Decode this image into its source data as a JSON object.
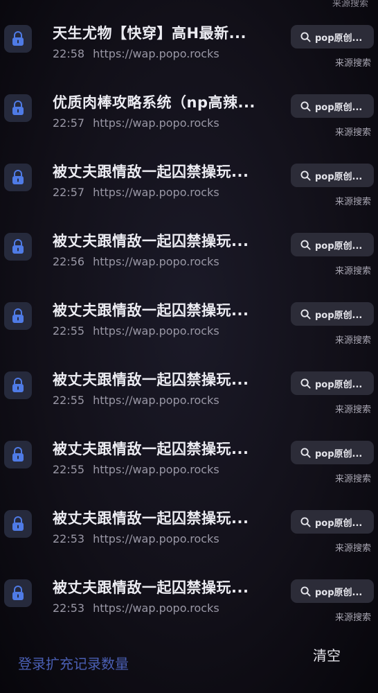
{
  "header": {
    "partial_text": "来源搜索"
  },
  "history": {
    "search_button_label": "pop原创...",
    "source_label": "来源搜索",
    "items": [
      {
        "title": "天生尤物【快穿】高H最新...",
        "time": "22:58",
        "url": "https://wap.popo.rocks"
      },
      {
        "title": "优质肉棒攻略系统（np高辣...",
        "time": "22:57",
        "url": "https://wap.popo.rocks"
      },
      {
        "title": "被丈夫跟情敌一起囚禁操玩...",
        "time": "22:57",
        "url": "https://wap.popo.rocks"
      },
      {
        "title": "被丈夫跟情敌一起囚禁操玩...",
        "time": "22:56",
        "url": "https://wap.popo.rocks"
      },
      {
        "title": "被丈夫跟情敌一起囚禁操玩...",
        "time": "22:55",
        "url": "https://wap.popo.rocks"
      },
      {
        "title": "被丈夫跟情敌一起囚禁操玩...",
        "time": "22:55",
        "url": "https://wap.popo.rocks"
      },
      {
        "title": "被丈夫跟情敌一起囚禁操玩...",
        "time": "22:55",
        "url": "https://wap.popo.rocks"
      },
      {
        "title": "被丈夫跟情敌一起囚禁操玩...",
        "time": "22:53",
        "url": "https://wap.popo.rocks"
      },
      {
        "title": "被丈夫跟情敌一起囚禁操玩...",
        "time": "22:53",
        "url": "https://wap.popo.rocks"
      }
    ]
  },
  "footer": {
    "expand_link": "登录扩充记录数量",
    "clear_button": "清空"
  },
  "icons": {
    "app": "lock-app-icon",
    "search": "search-icon"
  },
  "colors": {
    "background": "#121019",
    "app_icon_glyph": "#4f7be6",
    "link": "#4a5fb4",
    "pill_background": "#2c2c38"
  }
}
